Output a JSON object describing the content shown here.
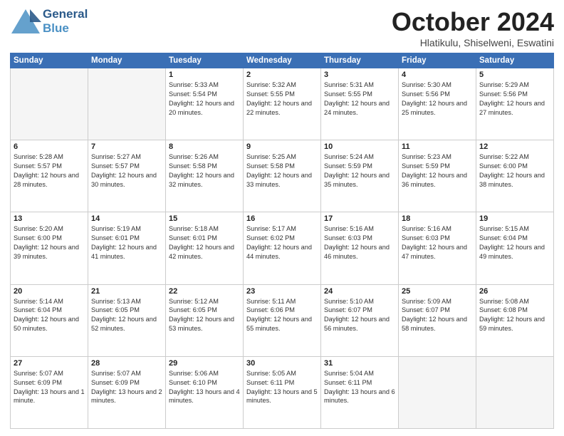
{
  "header": {
    "logo_line1": "General",
    "logo_line2": "Blue",
    "month": "October 2024",
    "location": "Hlatikulu, Shiselweni, Eswatini"
  },
  "weekdays": [
    "Sunday",
    "Monday",
    "Tuesday",
    "Wednesday",
    "Thursday",
    "Friday",
    "Saturday"
  ],
  "weeks": [
    [
      {
        "day": "",
        "info": ""
      },
      {
        "day": "",
        "info": ""
      },
      {
        "day": "1",
        "sunrise": "5:33 AM",
        "sunset": "5:54 PM",
        "daylight": "12 hours and 20 minutes."
      },
      {
        "day": "2",
        "sunrise": "5:32 AM",
        "sunset": "5:55 PM",
        "daylight": "12 hours and 22 minutes."
      },
      {
        "day": "3",
        "sunrise": "5:31 AM",
        "sunset": "5:55 PM",
        "daylight": "12 hours and 24 minutes."
      },
      {
        "day": "4",
        "sunrise": "5:30 AM",
        "sunset": "5:56 PM",
        "daylight": "12 hours and 25 minutes."
      },
      {
        "day": "5",
        "sunrise": "5:29 AM",
        "sunset": "5:56 PM",
        "daylight": "12 hours and 27 minutes."
      }
    ],
    [
      {
        "day": "6",
        "sunrise": "5:28 AM",
        "sunset": "5:57 PM",
        "daylight": "12 hours and 28 minutes."
      },
      {
        "day": "7",
        "sunrise": "5:27 AM",
        "sunset": "5:57 PM",
        "daylight": "12 hours and 30 minutes."
      },
      {
        "day": "8",
        "sunrise": "5:26 AM",
        "sunset": "5:58 PM",
        "daylight": "12 hours and 32 minutes."
      },
      {
        "day": "9",
        "sunrise": "5:25 AM",
        "sunset": "5:58 PM",
        "daylight": "12 hours and 33 minutes."
      },
      {
        "day": "10",
        "sunrise": "5:24 AM",
        "sunset": "5:59 PM",
        "daylight": "12 hours and 35 minutes."
      },
      {
        "day": "11",
        "sunrise": "5:23 AM",
        "sunset": "5:59 PM",
        "daylight": "12 hours and 36 minutes."
      },
      {
        "day": "12",
        "sunrise": "5:22 AM",
        "sunset": "6:00 PM",
        "daylight": "12 hours and 38 minutes."
      }
    ],
    [
      {
        "day": "13",
        "sunrise": "5:20 AM",
        "sunset": "6:00 PM",
        "daylight": "12 hours and 39 minutes."
      },
      {
        "day": "14",
        "sunrise": "5:19 AM",
        "sunset": "6:01 PM",
        "daylight": "12 hours and 41 minutes."
      },
      {
        "day": "15",
        "sunrise": "5:18 AM",
        "sunset": "6:01 PM",
        "daylight": "12 hours and 42 minutes."
      },
      {
        "day": "16",
        "sunrise": "5:17 AM",
        "sunset": "6:02 PM",
        "daylight": "12 hours and 44 minutes."
      },
      {
        "day": "17",
        "sunrise": "5:16 AM",
        "sunset": "6:03 PM",
        "daylight": "12 hours and 46 minutes."
      },
      {
        "day": "18",
        "sunrise": "5:16 AM",
        "sunset": "6:03 PM",
        "daylight": "12 hours and 47 minutes."
      },
      {
        "day": "19",
        "sunrise": "5:15 AM",
        "sunset": "6:04 PM",
        "daylight": "12 hours and 49 minutes."
      }
    ],
    [
      {
        "day": "20",
        "sunrise": "5:14 AM",
        "sunset": "6:04 PM",
        "daylight": "12 hours and 50 minutes."
      },
      {
        "day": "21",
        "sunrise": "5:13 AM",
        "sunset": "6:05 PM",
        "daylight": "12 hours and 52 minutes."
      },
      {
        "day": "22",
        "sunrise": "5:12 AM",
        "sunset": "6:05 PM",
        "daylight": "12 hours and 53 minutes."
      },
      {
        "day": "23",
        "sunrise": "5:11 AM",
        "sunset": "6:06 PM",
        "daylight": "12 hours and 55 minutes."
      },
      {
        "day": "24",
        "sunrise": "5:10 AM",
        "sunset": "6:07 PM",
        "daylight": "12 hours and 56 minutes."
      },
      {
        "day": "25",
        "sunrise": "5:09 AM",
        "sunset": "6:07 PM",
        "daylight": "12 hours and 58 minutes."
      },
      {
        "day": "26",
        "sunrise": "5:08 AM",
        "sunset": "6:08 PM",
        "daylight": "12 hours and 59 minutes."
      }
    ],
    [
      {
        "day": "27",
        "sunrise": "5:07 AM",
        "sunset": "6:09 PM",
        "daylight": "13 hours and 1 minute."
      },
      {
        "day": "28",
        "sunrise": "5:07 AM",
        "sunset": "6:09 PM",
        "daylight": "13 hours and 2 minutes."
      },
      {
        "day": "29",
        "sunrise": "5:06 AM",
        "sunset": "6:10 PM",
        "daylight": "13 hours and 4 minutes."
      },
      {
        "day": "30",
        "sunrise": "5:05 AM",
        "sunset": "6:11 PM",
        "daylight": "13 hours and 5 minutes."
      },
      {
        "day": "31",
        "sunrise": "5:04 AM",
        "sunset": "6:11 PM",
        "daylight": "13 hours and 6 minutes."
      },
      {
        "day": "",
        "info": ""
      },
      {
        "day": "",
        "info": ""
      }
    ]
  ],
  "labels": {
    "sunrise": "Sunrise:",
    "sunset": "Sunset:",
    "daylight": "Daylight:"
  }
}
